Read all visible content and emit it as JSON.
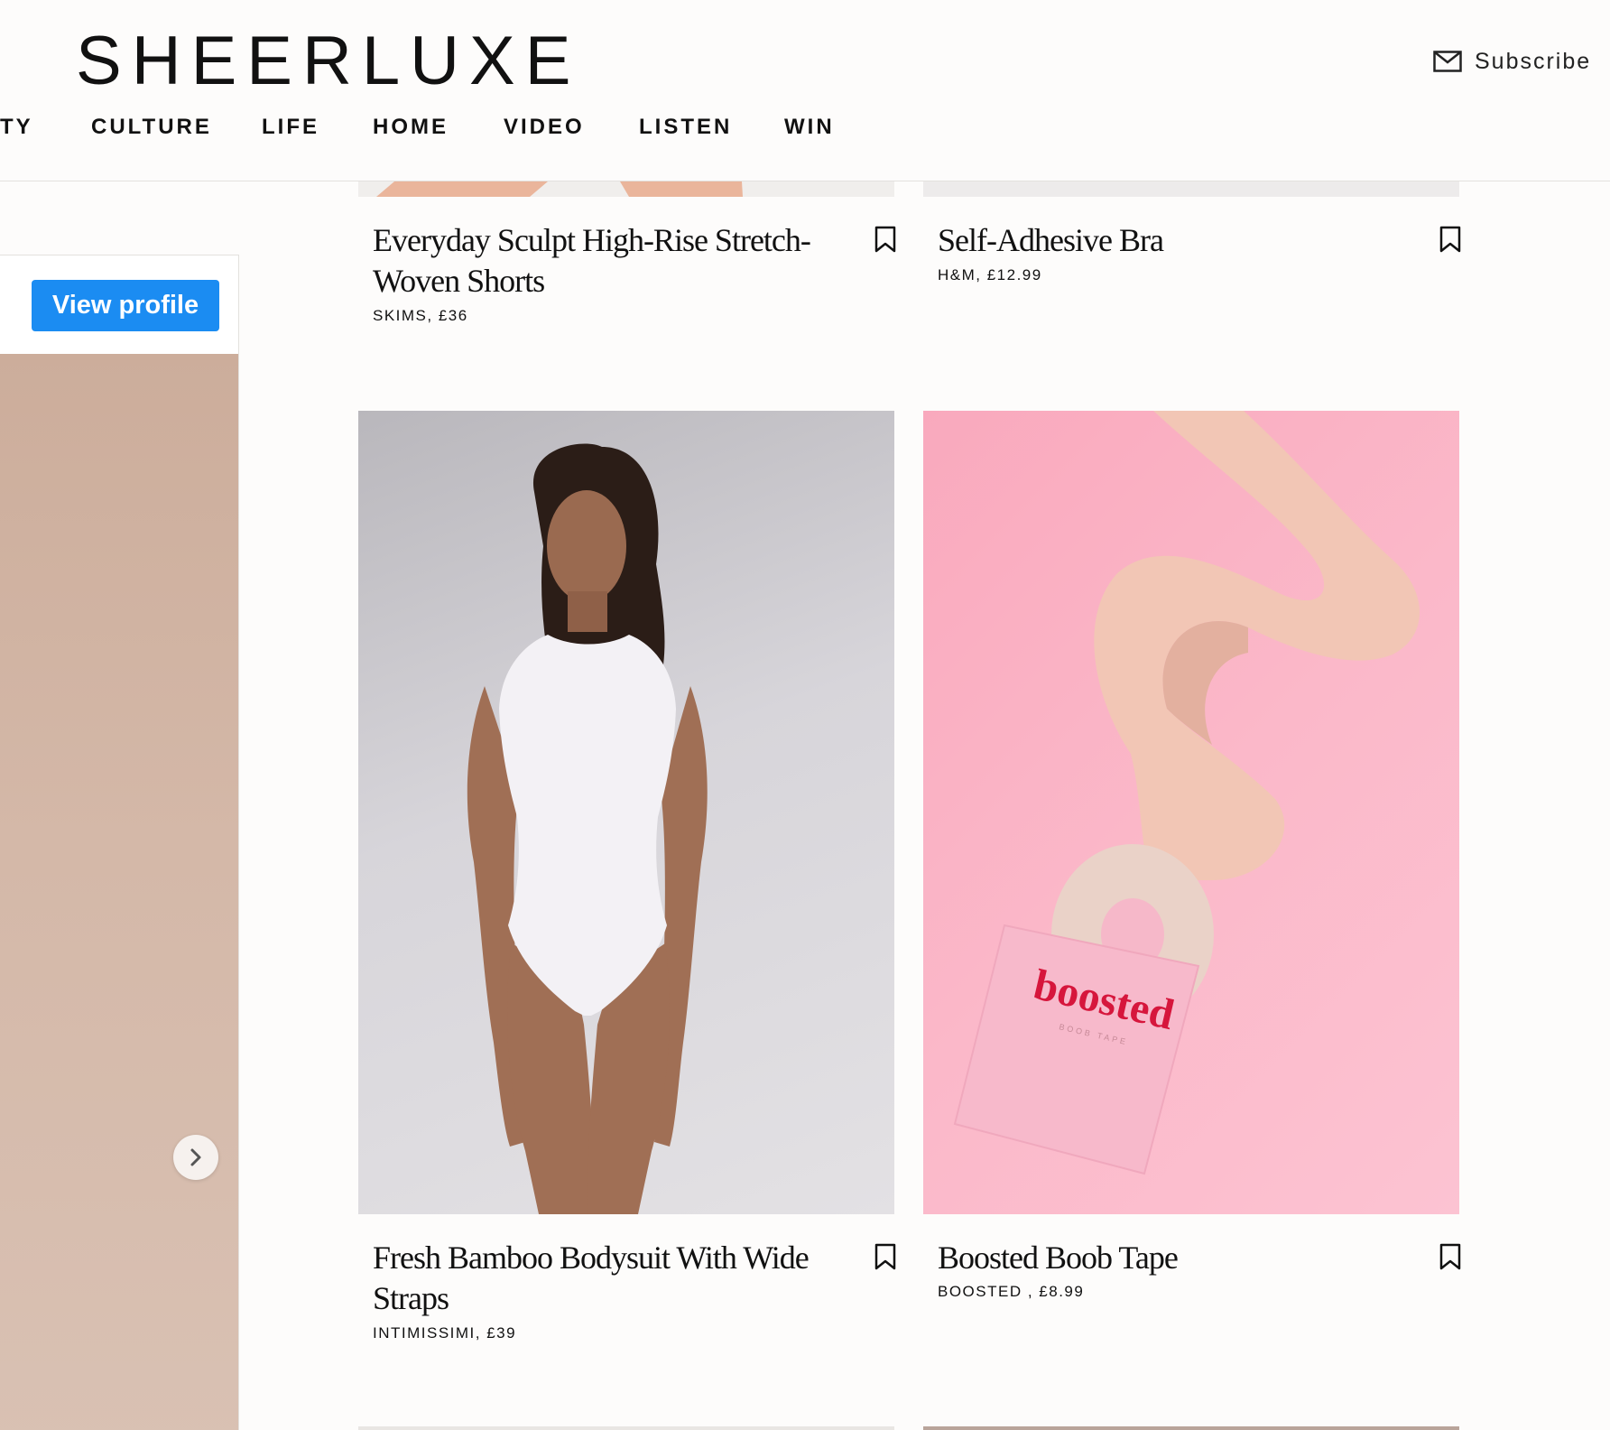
{
  "site": {
    "logo": "SHEERLUXE",
    "subscribe_label": "Subscribe"
  },
  "nav": {
    "items": [
      "TY",
      "CULTURE",
      "LIFE",
      "HOME",
      "VIDEO",
      "LISTEN",
      "WIN"
    ]
  },
  "sidebar": {
    "view_profile_label": "View profile"
  },
  "products": [
    {
      "title": "Everyday Sculpt High-Rise Stretch-Woven Shorts",
      "meta": "SKIMS, £36"
    },
    {
      "title": "Self-Adhesive Bra",
      "meta": "H&M, £12.99"
    },
    {
      "title": "Fresh Bamboo Bodysuit With Wide Straps",
      "meta": "INTIMISSIMI, £39"
    },
    {
      "title": "Boosted Boob Tape",
      "meta": "BOOSTED , £8.99"
    }
  ],
  "images": {
    "tape_box_brand": "boosted",
    "tape_box_sub": "BOOB TAPE"
  },
  "colors": {
    "accent_button": "#1b8cf2",
    "tape_background": "#fbb3c6",
    "bodysuit_background": "#d2d0d6"
  }
}
